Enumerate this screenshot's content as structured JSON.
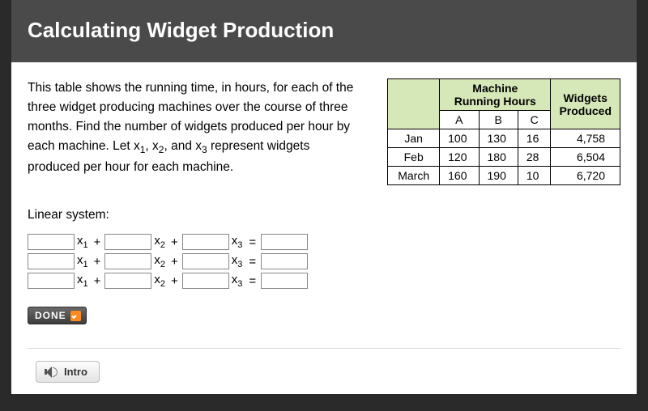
{
  "header": {
    "title": "Calculating Widget Production"
  },
  "problem": {
    "text_html": "This table shows the running time, in hours, for each of the three widget producing machines over the course of three months. Find the number of widgets produced per hour by each machine. Let x<sub>1</sub>, x<sub>2</sub>, and x<sub>3</sub> represent widgets produced per hour for each machine."
  },
  "table": {
    "header_group": "Machine Running Hours",
    "header_widgets": "Widgets Produced",
    "cols": [
      "A",
      "B",
      "C"
    ],
    "rows": [
      {
        "label": "Jan",
        "a": "100",
        "b": "130",
        "c": "16",
        "w": "4,758"
      },
      {
        "label": "Feb",
        "a": "120",
        "b": "180",
        "c": "28",
        "w": "6,504"
      },
      {
        "label": "March",
        "a": "160",
        "b": "190",
        "c": "10",
        "w": "6,720"
      }
    ]
  },
  "linear": {
    "label": "Linear system:",
    "vars": [
      "x1",
      "x2",
      "x3"
    ],
    "rows": 3
  },
  "buttons": {
    "done": "DONE",
    "intro": "Intro"
  }
}
